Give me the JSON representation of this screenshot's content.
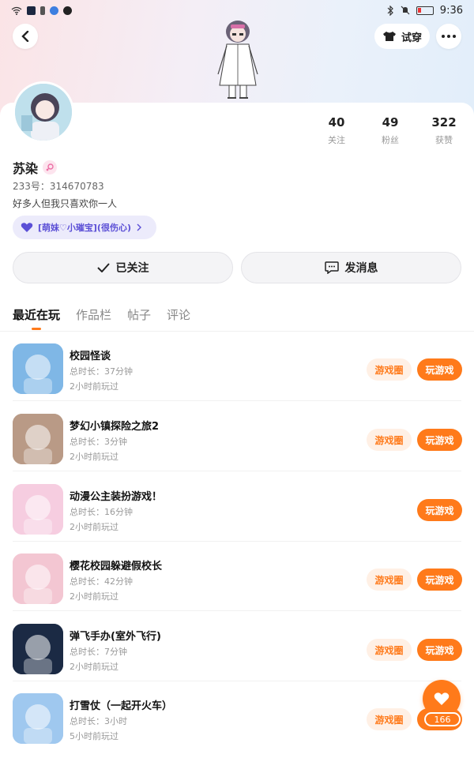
{
  "status_bar": {
    "time": "9:36"
  },
  "header": {
    "tryon_label": "试穿"
  },
  "profile": {
    "name": "苏染",
    "uid": "233号：314670783",
    "bio": "好多人但我只喜欢你一人",
    "family_tag": "[萌妹♡小璀宝](很伤心)",
    "stats": [
      {
        "value": "40",
        "label": "关注"
      },
      {
        "value": "49",
        "label": "粉丝"
      },
      {
        "value": "322",
        "label": "获赞"
      }
    ]
  },
  "actions": {
    "follow": "已关注",
    "message": "发消息"
  },
  "tabs": [
    "最近在玩",
    "作品栏",
    "帖子",
    "评论"
  ],
  "buttons": {
    "circle": "游戏圈",
    "play": "玩游戏"
  },
  "games": [
    {
      "name": "校园怪谈",
      "duration": "总时长：37分钟",
      "last": "2小时前玩过",
      "has_circle": true,
      "icon_color": "#7fb7e6"
    },
    {
      "name": "梦幻小镇探险之旅2",
      "duration": "总时长：3分钟",
      "last": "2小时前玩过",
      "has_circle": true,
      "icon_color": "#b99a86"
    },
    {
      "name": "动漫公主装扮游戏！",
      "duration": "总时长：16分钟",
      "last": "2小时前玩过",
      "has_circle": false,
      "icon_color": "#f6cde0"
    },
    {
      "name": "樱花校园躲避假校长",
      "duration": "总时长：42分钟",
      "last": "2小时前玩过",
      "has_circle": true,
      "icon_color": "#f3c6d2"
    },
    {
      "name": "弹飞手办(室外飞行)",
      "duration": "总时长：7分钟",
      "last": "2小时前玩过",
      "has_circle": true,
      "icon_color": "#1b2a44"
    },
    {
      "name": "打雪仗（一起开火车）",
      "duration": "总时长：3小时",
      "last": "5小时前玩过",
      "has_circle": true,
      "icon_color": "#9fc8ef"
    }
  ],
  "fab": {
    "count": "166"
  },
  "colors": {
    "accent": "#ff7a1a",
    "accent_light": "#fff0e5",
    "tag_purple": "#5b4fd6"
  }
}
